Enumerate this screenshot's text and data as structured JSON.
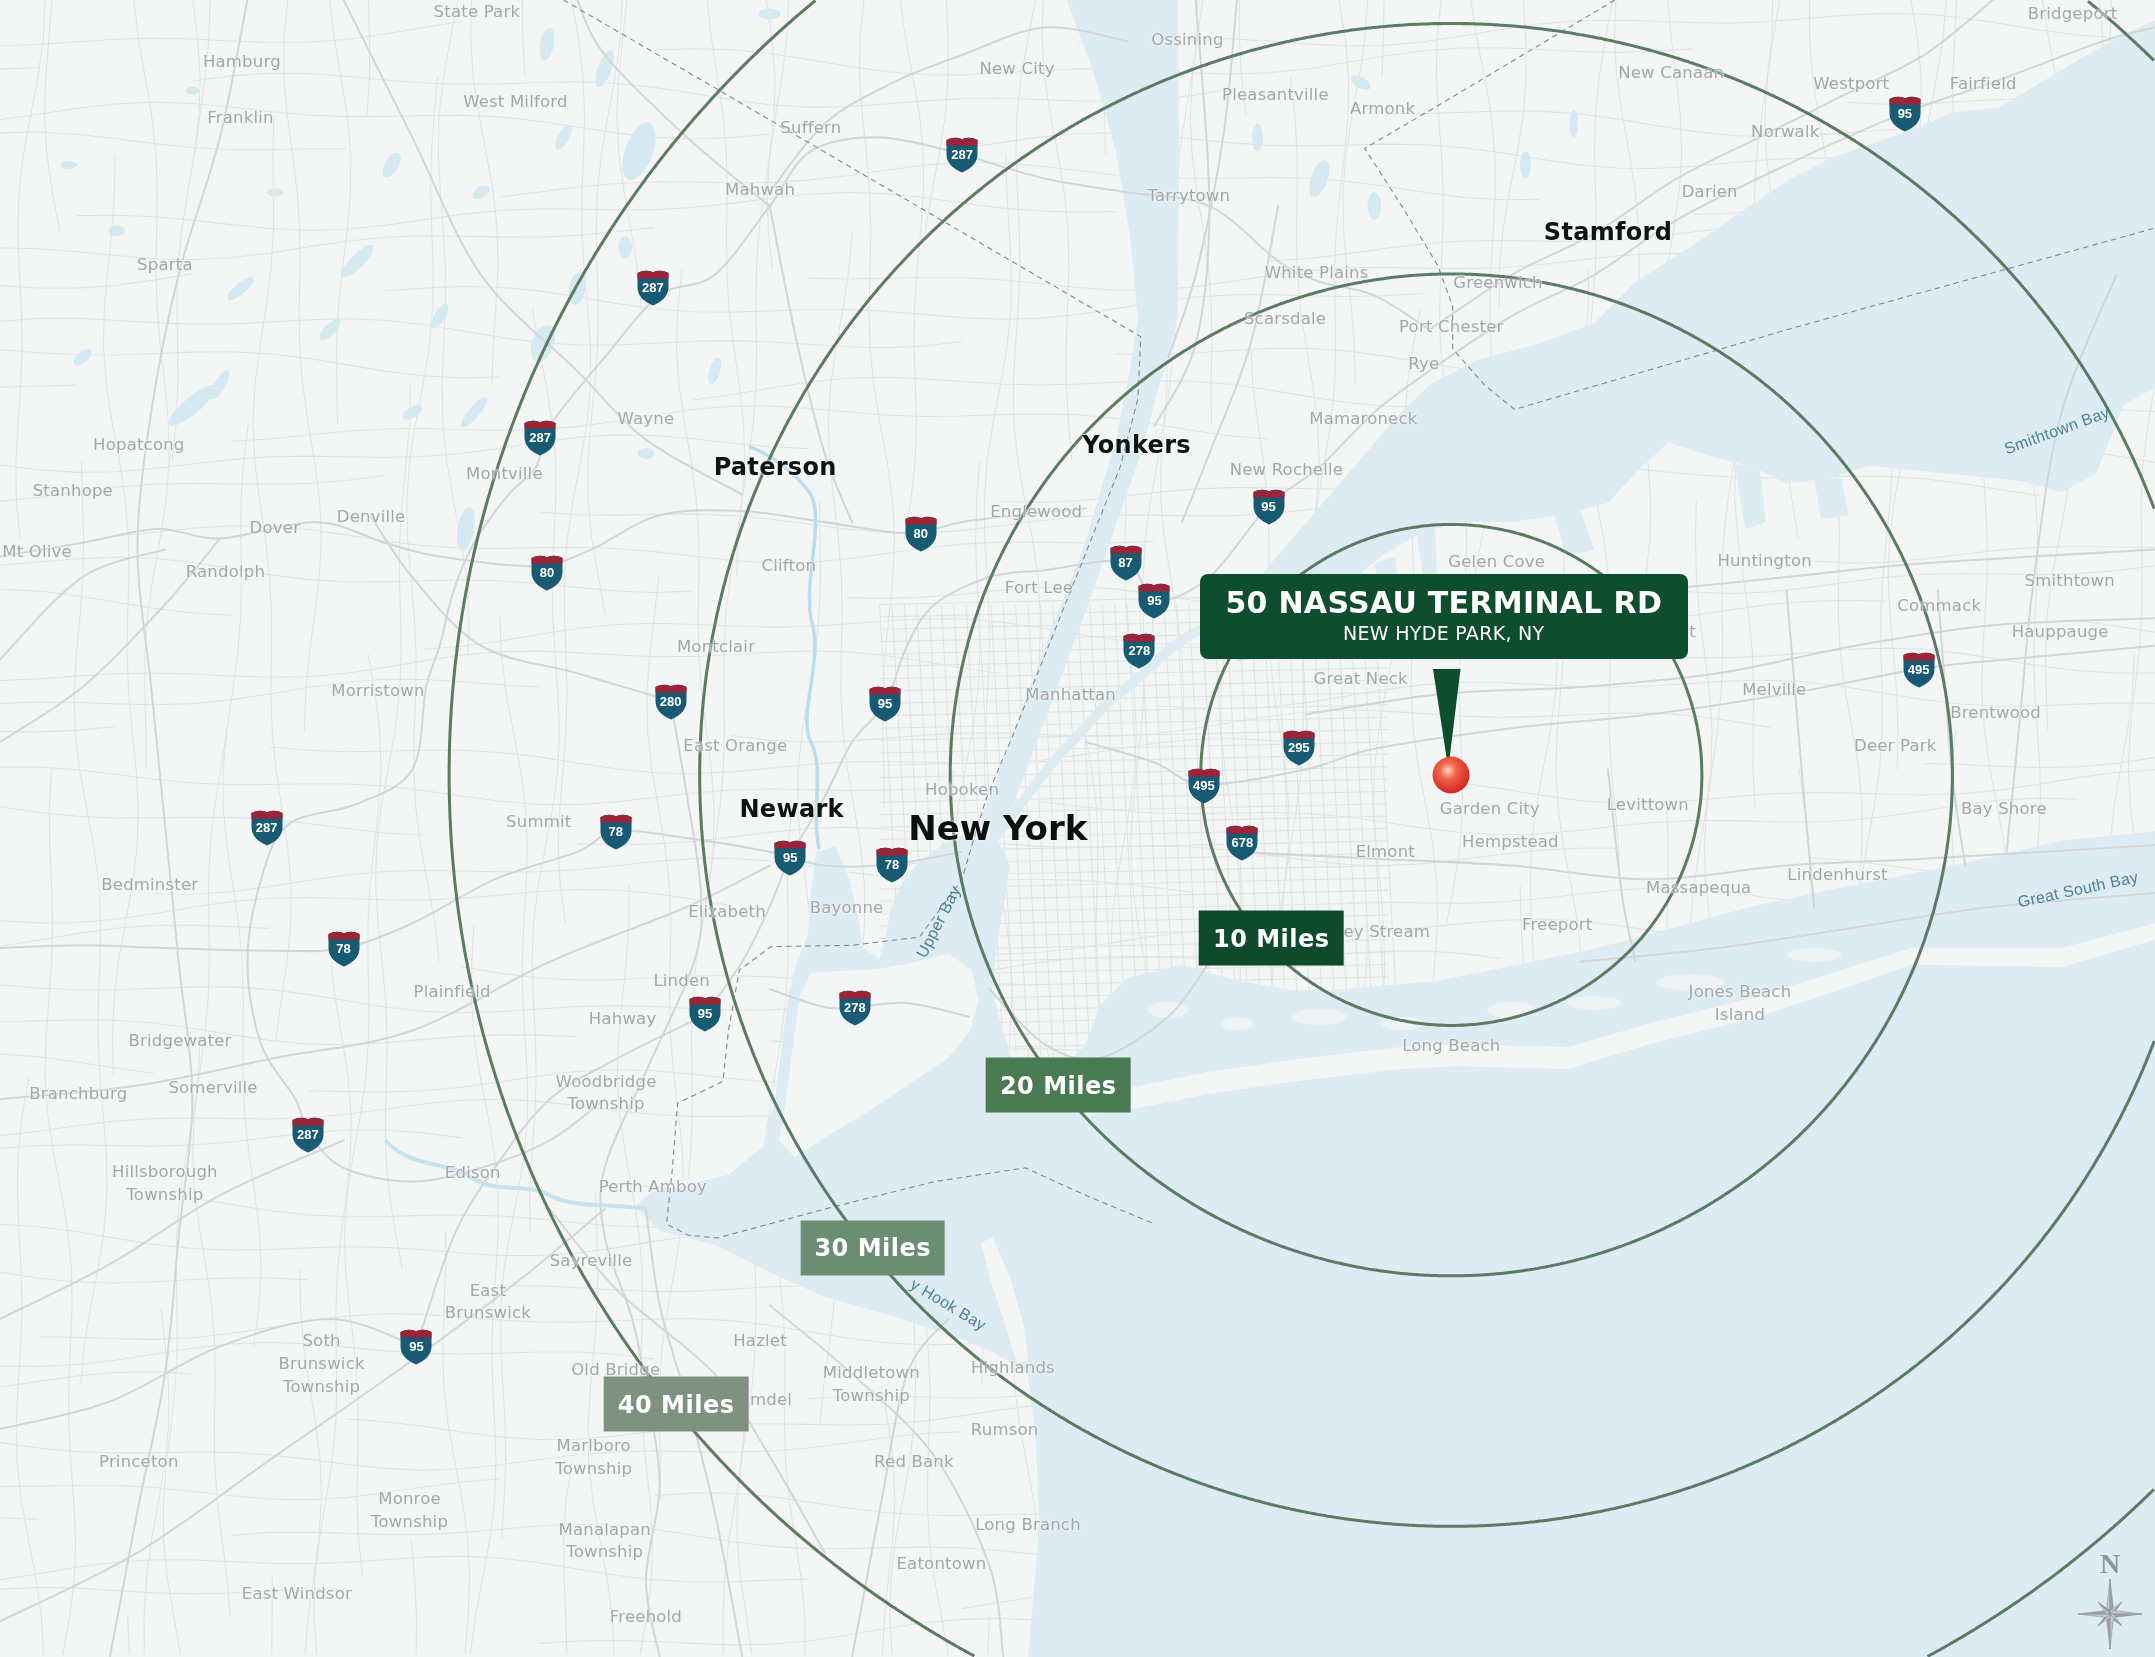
{
  "map": {
    "places": [
      {
        "name": "State Park",
        "kind": "town"
      },
      {
        "name": "Bridgeport",
        "kind": "town"
      },
      {
        "name": "Ossining",
        "kind": "town"
      },
      {
        "name": "Hamburg",
        "kind": "town"
      },
      {
        "name": "New City",
        "kind": "town"
      },
      {
        "name": "New Canaan",
        "kind": "town"
      },
      {
        "name": "Pleasantville",
        "kind": "town"
      },
      {
        "name": "Westport",
        "kind": "town"
      },
      {
        "name": "Fairfield",
        "kind": "town"
      },
      {
        "name": "Franklin",
        "kind": "town"
      },
      {
        "name": "West Milford",
        "kind": "town"
      },
      {
        "name": "Armonk",
        "kind": "town"
      },
      {
        "name": "Suffern",
        "kind": "town"
      },
      {
        "name": "Norwalk",
        "kind": "town"
      },
      {
        "name": "Mahwah",
        "kind": "town"
      },
      {
        "name": "Tarrytown",
        "kind": "town"
      },
      {
        "name": "Darien",
        "kind": "town"
      },
      {
        "name": "Stamford",
        "kind": "city"
      },
      {
        "name": "Sparta",
        "kind": "town"
      },
      {
        "name": "White Plains",
        "kind": "town"
      },
      {
        "name": "Greenwich",
        "kind": "town"
      },
      {
        "name": "Scarsdale",
        "kind": "town"
      },
      {
        "name": "Port Chester",
        "kind": "town"
      },
      {
        "name": "Rye",
        "kind": "town"
      },
      {
        "name": "Wayne",
        "kind": "town"
      },
      {
        "name": "Mamaroneck",
        "kind": "town"
      },
      {
        "name": "Hopatcong",
        "kind": "town"
      },
      {
        "name": "Yonkers",
        "kind": "city"
      },
      {
        "name": "Montville",
        "kind": "town"
      },
      {
        "name": "Paterson",
        "kind": "city"
      },
      {
        "name": "New Rochelle",
        "kind": "town"
      },
      {
        "name": "Stanhope",
        "kind": "town"
      },
      {
        "name": "Dover",
        "kind": "town"
      },
      {
        "name": "Denville",
        "kind": "town"
      },
      {
        "name": "Englewood",
        "kind": "town"
      },
      {
        "name": "Mt Olive",
        "kind": "town"
      },
      {
        "name": "Randolph",
        "kind": "town"
      },
      {
        "name": "Clifton",
        "kind": "town"
      },
      {
        "name": "Fort Lee",
        "kind": "town"
      },
      {
        "name": "Gelen Cove",
        "kind": "town"
      },
      {
        "name": "Huntington",
        "kind": "town"
      },
      {
        "name": "Smithtown",
        "kind": "town"
      },
      {
        "name": "Commack",
        "kind": "town"
      },
      {
        "name": "Montclair",
        "kind": "town"
      },
      {
        "name": "t",
        "kind": "town"
      },
      {
        "name": "Hauppauge",
        "kind": "town"
      },
      {
        "name": "Morristown",
        "kind": "town"
      },
      {
        "name": "Manhattan",
        "kind": "town"
      },
      {
        "name": "Great Neck",
        "kind": "town"
      },
      {
        "name": "Melville",
        "kind": "town"
      },
      {
        "name": "Brentwood",
        "kind": "town"
      },
      {
        "name": "East Orange",
        "kind": "town"
      },
      {
        "name": "Deer Park",
        "kind": "town"
      },
      {
        "name": "Hoboken",
        "kind": "town"
      },
      {
        "name": "Summit",
        "kind": "town"
      },
      {
        "name": "Newark",
        "kind": "city"
      },
      {
        "name": "New York",
        "kind": "metro"
      },
      {
        "name": "Garden City",
        "kind": "town"
      },
      {
        "name": "Levittown",
        "kind": "town"
      },
      {
        "name": "Bay Shore",
        "kind": "town"
      },
      {
        "name": "Elmont",
        "kind": "town"
      },
      {
        "name": "Hempstead",
        "kind": "town"
      },
      {
        "name": "Bedminster",
        "kind": "town"
      },
      {
        "name": "Massapequa",
        "kind": "town"
      },
      {
        "name": "Lindenhurst",
        "kind": "town"
      },
      {
        "name": "Elizabeth",
        "kind": "town"
      },
      {
        "name": "Bayonne",
        "kind": "town"
      },
      {
        "name": "ey Stream",
        "kind": "town"
      },
      {
        "name": "Freeport",
        "kind": "town"
      },
      {
        "name": "Plainfield",
        "kind": "town"
      },
      {
        "name": "Hahway",
        "kind": "town"
      },
      {
        "name": "Linden",
        "kind": "town"
      },
      {
        "name": "Jones Beach Island",
        "kind": "town"
      },
      {
        "name": "Bridgewater",
        "kind": "town"
      },
      {
        "name": "Long Beach",
        "kind": "town"
      },
      {
        "name": "Branchburg",
        "kind": "town"
      },
      {
        "name": "Somerville",
        "kind": "town"
      },
      {
        "name": "Woodbridge Township",
        "kind": "town"
      },
      {
        "name": "Hillsborough Township",
        "kind": "town"
      },
      {
        "name": "Edison",
        "kind": "town"
      },
      {
        "name": "Perth Amboy",
        "kind": "town"
      },
      {
        "name": "Sayreville",
        "kind": "town"
      },
      {
        "name": "East Brunswick",
        "kind": "town"
      },
      {
        "name": "Soth Brunswick Township",
        "kind": "town"
      },
      {
        "name": "Old Bridge",
        "kind": "town"
      },
      {
        "name": "Hazlet",
        "kind": "town"
      },
      {
        "name": "mdel",
        "kind": "town"
      },
      {
        "name": "Middletown Township",
        "kind": "town"
      },
      {
        "name": "Highlands",
        "kind": "town"
      },
      {
        "name": "Rumson",
        "kind": "town"
      },
      {
        "name": "Princeton",
        "kind": "town"
      },
      {
        "name": "Marlboro Township",
        "kind": "town"
      },
      {
        "name": "Red Bank",
        "kind": "town"
      },
      {
        "name": "Monroe Township",
        "kind": "town"
      },
      {
        "name": "Manalapan Township",
        "kind": "town"
      },
      {
        "name": "Long Branch",
        "kind": "town"
      },
      {
        "name": "Eatontown",
        "kind": "town"
      },
      {
        "name": "East Windsor",
        "kind": "town"
      },
      {
        "name": "Freehold",
        "kind": "town"
      }
    ],
    "water_labels": [
      "Smithtown Bay",
      "Upper Bay",
      "Great South Bay",
      "y Hook Bay"
    ],
    "highway_shields": [
      "95",
      "287",
      "287",
      "287",
      "80",
      "95",
      "80",
      "87",
      "95",
      "278",
      "495",
      "280",
      "95",
      "295",
      "495",
      "287",
      "78",
      "95",
      "78",
      "678",
      "78",
      "95",
      "278",
      "287",
      "95"
    ],
    "radius_rings": [
      {
        "label": "10 Miles",
        "color": "#0e4b2b"
      },
      {
        "label": "20 Miles",
        "color": "#4a7a52"
      },
      {
        "label": "30 Miles",
        "color": "#6b8d72"
      },
      {
        "label": "40 Miles",
        "color": "#7f927f"
      }
    ],
    "site": {
      "address": "50 NASSAU TERMINAL RD",
      "locality": "NEW HYDE PARK, NY"
    },
    "compass": {
      "letter": "N"
    }
  }
}
